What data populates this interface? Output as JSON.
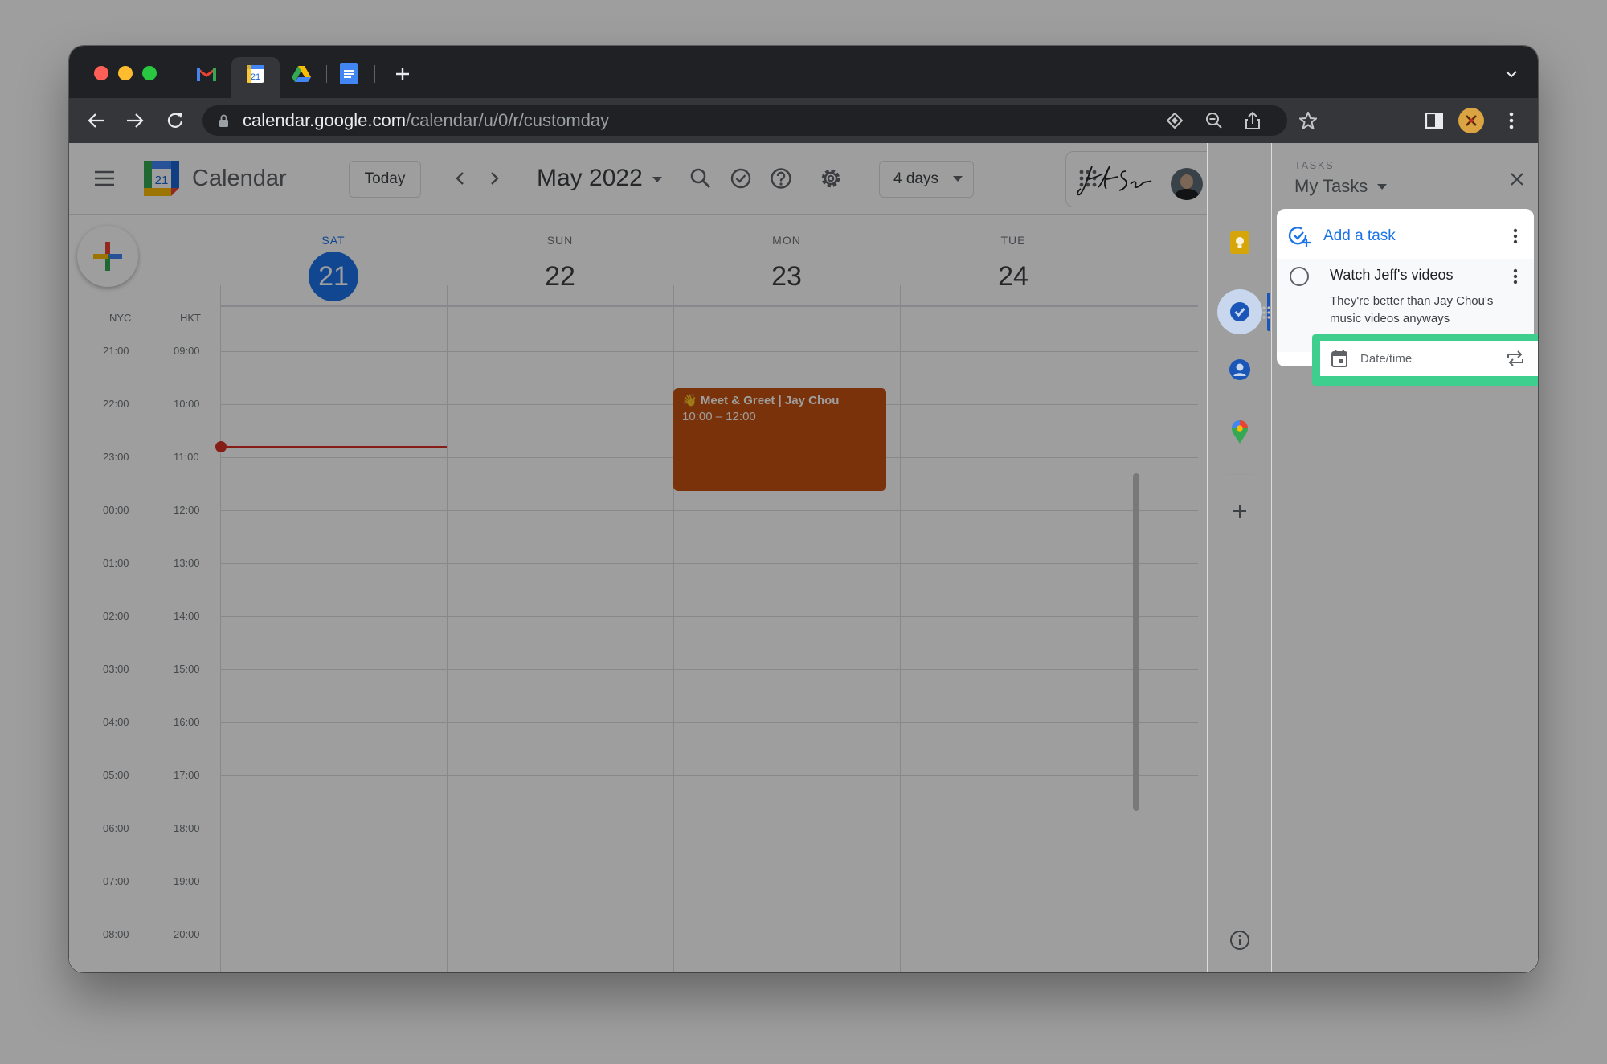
{
  "browser": {
    "url_host": "calendar.google.com",
    "url_path": "/calendar/u/0/r/customday",
    "tabs": [
      {
        "icon": "gmail-icon"
      },
      {
        "icon": "calendar-icon",
        "badge": "21",
        "active": true
      },
      {
        "icon": "drive-icon"
      },
      {
        "icon": "docs-icon"
      }
    ]
  },
  "header": {
    "app_name": "Calendar",
    "logo_badge": "21",
    "today_label": "Today",
    "month_label": "May 2022",
    "view_label": "4 days"
  },
  "days": [
    {
      "dow": "SAT",
      "num": "21",
      "today": true
    },
    {
      "dow": "SUN",
      "num": "22"
    },
    {
      "dow": "MON",
      "num": "23"
    },
    {
      "dow": "TUE",
      "num": "24"
    }
  ],
  "timezones": {
    "primary": "NYC",
    "secondary": "HKT"
  },
  "time_rows": [
    {
      "nyc": "21:00",
      "hkt": "09:00"
    },
    {
      "nyc": "22:00",
      "hkt": "10:00"
    },
    {
      "nyc": "23:00",
      "hkt": "11:00"
    },
    {
      "nyc": "00:00",
      "hkt": "12:00"
    },
    {
      "nyc": "01:00",
      "hkt": "13:00"
    },
    {
      "nyc": "02:00",
      "hkt": "14:00"
    },
    {
      "nyc": "03:00",
      "hkt": "15:00"
    },
    {
      "nyc": "04:00",
      "hkt": "16:00"
    },
    {
      "nyc": "05:00",
      "hkt": "17:00"
    },
    {
      "nyc": "06:00",
      "hkt": "18:00"
    },
    {
      "nyc": "07:00",
      "hkt": "19:00"
    },
    {
      "nyc": "08:00",
      "hkt": "20:00"
    }
  ],
  "event": {
    "emoji": "👋",
    "title": "Meet & Greet | Jay Chou",
    "time": "10:00 – 12:00",
    "color": "#c65211"
  },
  "tasks": {
    "heading": "TASKS",
    "list_name": "My Tasks",
    "add_label": "Add a task",
    "task_title": "Watch Jeff's videos",
    "task_notes": "They're better than Jay Chou's music videos anyways",
    "date_placeholder": "Date/time"
  },
  "colors": {
    "accent": "#1a73e8",
    "highlight": "#3ecf8e",
    "event": "#c65211",
    "now_line": "#d93025"
  }
}
